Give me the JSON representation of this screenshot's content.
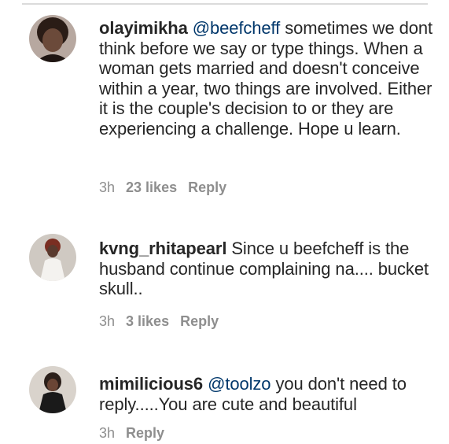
{
  "comments": [
    {
      "username": "olayimikha",
      "mention": "@beefcheff",
      "text": " sometimes we dont think before we say or type things. When a woman gets married and doesn't conceive within a year, two things are involved. Either it is the couple's decision  to or they are experiencing a challenge. Hope u learn.",
      "time": "3h",
      "likes": "23 likes",
      "reply": "Reply"
    },
    {
      "username": "kvng_rhitapearl",
      "mention": "",
      "text": " Since u beefcheff is the husband continue complaining na.... bucket skull..",
      "time": "3h",
      "likes": "3 likes",
      "reply": "Reply"
    },
    {
      "username": "mimilicious6",
      "mention": "@toolzo",
      "text": " you don't need to reply.....You are cute and beautiful",
      "time": "3h",
      "likes": "",
      "reply": "Reply"
    }
  ],
  "colors": {
    "text": "#262626",
    "mention": "#00376b",
    "meta": "#8e8e8e"
  }
}
